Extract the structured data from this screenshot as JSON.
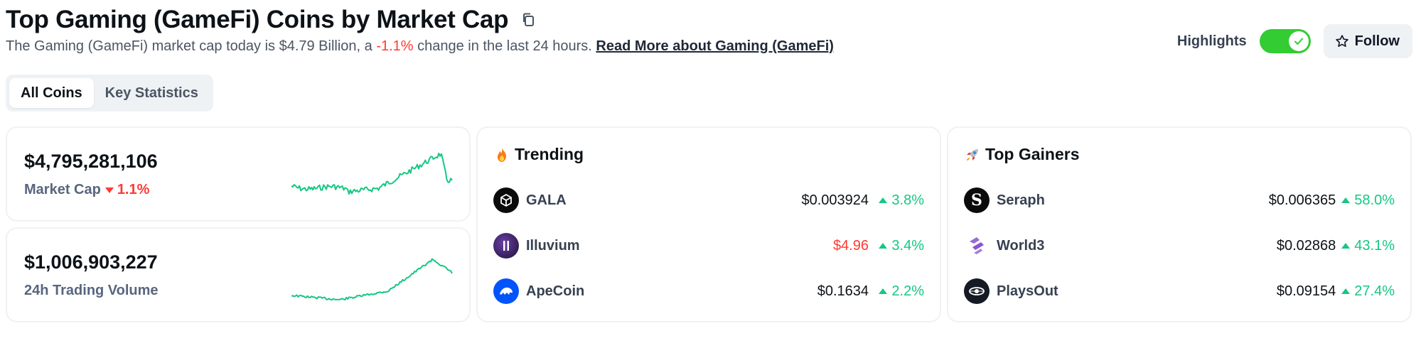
{
  "header": {
    "title": "Top Gaming (GameFi) Coins by Market Cap",
    "subtitle_prefix": "The Gaming (GameFi) market cap today is $4.79 Billion, a ",
    "subtitle_change": "-1.1%",
    "subtitle_suffix": " change in the last 24 hours. ",
    "read_more": "Read More about Gaming (GameFi)",
    "highlights_label": "Highlights",
    "highlights_on": true,
    "follow_label": "Follow"
  },
  "tabs": [
    {
      "label": "All Coins",
      "active": true
    },
    {
      "label": "Key Statistics",
      "active": false
    }
  ],
  "stats": {
    "market_cap": {
      "value": "$4,795,281,106",
      "label": "Market Cap",
      "change": "1.1%",
      "direction": "down"
    },
    "volume": {
      "value": "$1,006,903,227",
      "label": "24h Trading Volume"
    }
  },
  "trending": {
    "title": "Trending",
    "icon": "fire-icon",
    "coins": [
      {
        "name": "GALA",
        "price": "$0.003924",
        "change": "3.8%",
        "price_color": "default"
      },
      {
        "name": "Illuvium",
        "price": "$4.96",
        "change": "3.4%",
        "price_color": "red"
      },
      {
        "name": "ApeCoin",
        "price": "$0.1634",
        "change": "2.2%",
        "price_color": "default"
      }
    ]
  },
  "gainers": {
    "title": "Top Gainers",
    "icon": "rocket-icon",
    "coins": [
      {
        "name": "Seraph",
        "price": "$0.006365",
        "change": "58.0%"
      },
      {
        "name": "World3",
        "price": "$0.02868",
        "change": "43.1%"
      },
      {
        "name": "PlaysOut",
        "price": "$0.09154",
        "change": "27.4%"
      }
    ]
  },
  "colors": {
    "positive": "#16c784",
    "negative": "#ff3a33",
    "toggle_on": "#33cc33",
    "sparkline": "#16c784"
  }
}
